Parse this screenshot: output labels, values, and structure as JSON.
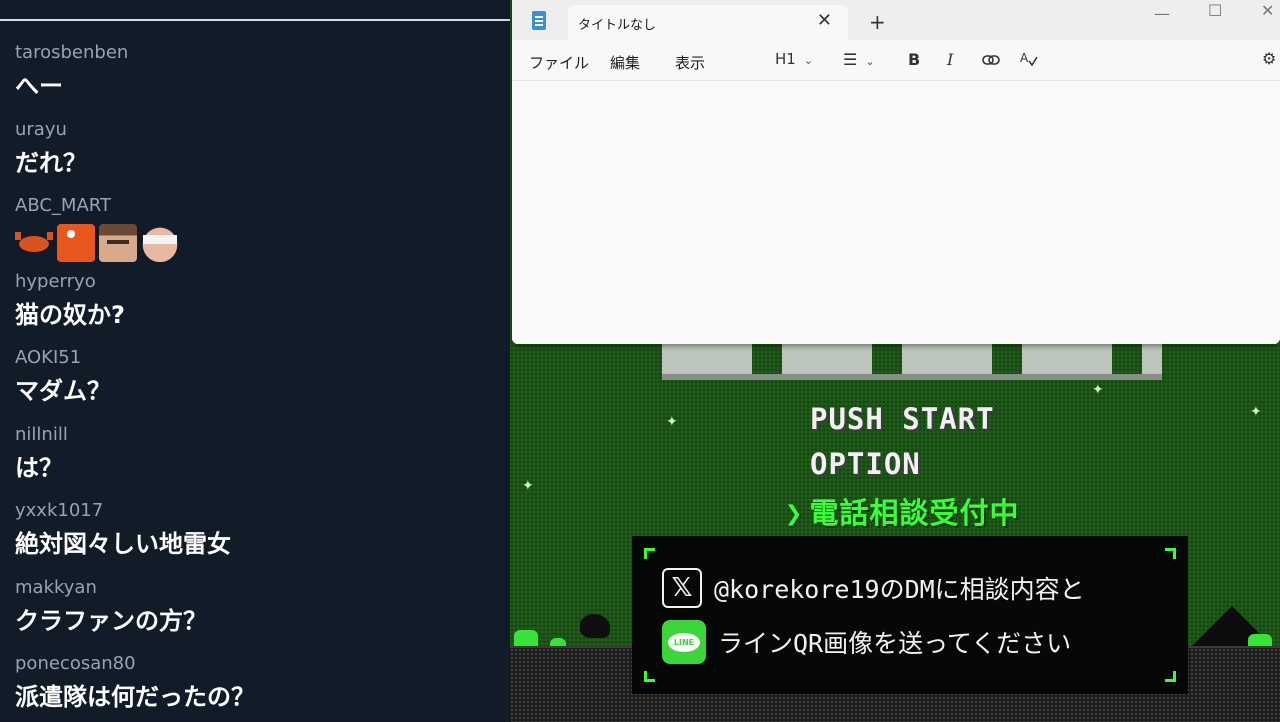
{
  "chat": {
    "messages": [
      {
        "user": "tarosbenben",
        "text": "へー"
      },
      {
        "user": "urayu",
        "text": "だれ？"
      },
      {
        "user": "ABC_MART",
        "emotes": [
          "crab-emote",
          "fish-emote",
          "face-emote",
          "bandana-face-emote"
        ]
      },
      {
        "user": "hyperryo",
        "text": "猫の奴か?"
      },
      {
        "user": "AOKI51",
        "text": "マダム？"
      },
      {
        "user": "nillnill",
        "text": "は？"
      },
      {
        "user": "yxxk1017",
        "text": "絶対図々しい地雷女"
      },
      {
        "user": "makkyan",
        "text": "クラファンの方？"
      },
      {
        "user": "ponecosan80",
        "text": "派遣隊は何だったの？"
      }
    ]
  },
  "notepad": {
    "tab_title": "タイトルなし",
    "menu": {
      "file": "ファイル",
      "edit": "編集",
      "view": "表示"
    },
    "toolbar": {
      "heading": "H1",
      "bold": "B",
      "italic": "I",
      "link": "link-icon",
      "spellcheck": "spellcheck-icon"
    },
    "icons": {
      "close": "✕",
      "new_tab": "+",
      "minimize": "—",
      "maximize": "☐",
      "window_close": "✕",
      "list": "☰",
      "chevron": "⌄",
      "settings": "⚙"
    }
  },
  "game": {
    "menu": [
      "PUSH START",
      "OPTION"
    ],
    "active_item": "電話相談受付中",
    "arrow": "❯",
    "info": {
      "x_glyph": "𝕏",
      "line_glyph": "LINE",
      "x_text": "@korekore19のDMに相談内容と",
      "line_text": "ラインQR画像を送ってください"
    }
  },
  "colors": {
    "accent_green": "#39ff39",
    "chat_bg": "#121b28",
    "notepad_bg": "#f8f8f8"
  }
}
